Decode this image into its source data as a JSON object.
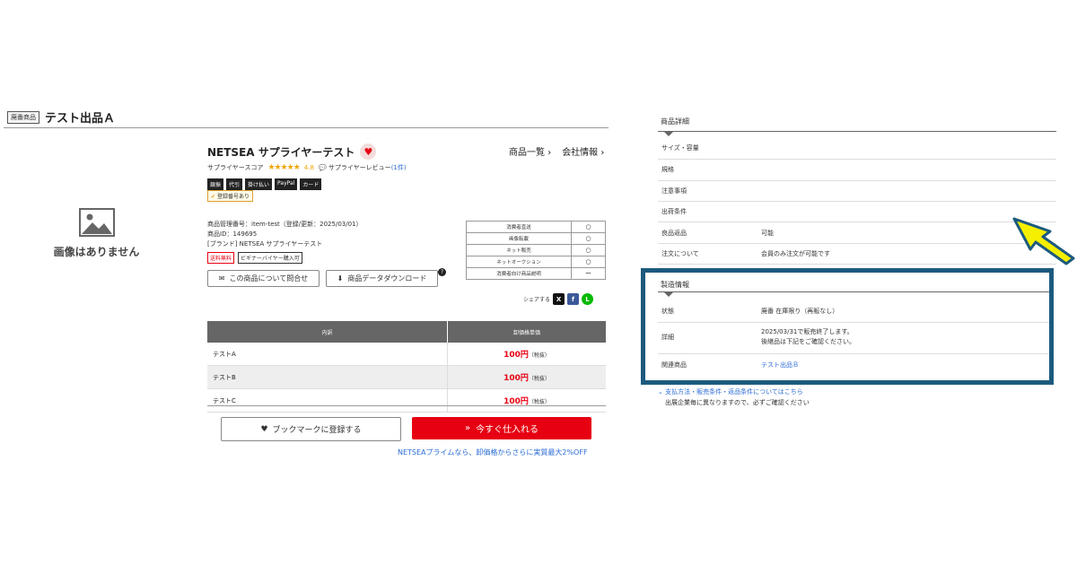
{
  "header": {
    "tag": "廃番商品",
    "title": "テスト出品Ａ"
  },
  "no_image": {
    "text": "画像はありません"
  },
  "supplier": {
    "name": "NETSEA サプライヤーテスト",
    "links": [
      "商品一覧",
      "会社情報"
    ],
    "score_label": "サプライヤースコア",
    "stars": "★★★★★",
    "score": "4.8",
    "review_label": "サプライヤーレビュー",
    "review_count": "(1件)",
    "payments": [
      "銀振",
      "代引",
      "掛け払い",
      "PayPal",
      "カード"
    ],
    "reg_no": "登録番号あり"
  },
  "product": {
    "manage_no": "商品管理番号：item-test（登録/更新：2025/03/01）",
    "product_id": "商品ID：149695",
    "brand": "[ブランド] NETSEA サプライヤーテスト",
    "badge_red": "送料無料",
    "badge_gray": "ビギナーバイヤー購入可",
    "inquiry_label": "この商品について問合せ",
    "download_label": "商品データダウンロード",
    "help": "?"
  },
  "features": [
    {
      "label": "消費者直送",
      "value": "○"
    },
    {
      "label": "画像転載",
      "value": "○"
    },
    {
      "label": "ネット販売",
      "value": "○"
    },
    {
      "label": "ネットオークション",
      "value": "○"
    },
    {
      "label": "消費者向け商品説明",
      "value": "ー"
    }
  ],
  "share": {
    "label": "シェアする",
    "buttons": [
      {
        "name": "x",
        "glyph": "X",
        "color": "#111111"
      },
      {
        "name": "facebook",
        "glyph": "f",
        "color": "#3b5998"
      },
      {
        "name": "line",
        "glyph": "L",
        "color": "#00b900"
      }
    ]
  },
  "price_table": {
    "headers": [
      "内訳",
      "卸価格単価"
    ],
    "rows": [
      {
        "name": "テストA",
        "price": "100円",
        "tax": "（税抜）"
      },
      {
        "name": "テストB",
        "price": "100円",
        "tax": "（税抜）"
      },
      {
        "name": "テストC",
        "price": "100円",
        "tax": "（税抜）"
      }
    ]
  },
  "actions": {
    "bookmark_label": "ブックマークに登録する",
    "buy_label": "今すぐ仕入れる",
    "prime_text": "NETSEAプライムなら、卸価格からさらに実質最大2%OFF"
  },
  "details": {
    "heading": "商品詳細",
    "rows": [
      {
        "label": "サイズ・容量",
        "value": ""
      },
      {
        "label": "規格",
        "value": ""
      },
      {
        "label": "注意事項",
        "value": ""
      },
      {
        "label": "出荷条件",
        "value": ""
      },
      {
        "label": "良品返品",
        "value": "可能"
      },
      {
        "label": "注文について",
        "value": "会員のみ注文が可能です"
      }
    ]
  },
  "manufacture": {
    "heading": "製造情報",
    "rows": [
      {
        "label": "状態",
        "value": "廃番 在庫限り（再販なし）"
      },
      {
        "label": "詳細",
        "value_line1": "2025/03/31で販売終了します。",
        "value_line2": "後継品は下記をご確認ください。"
      },
      {
        "label": "関連商品",
        "value": "テスト出品Ｂ"
      }
    ]
  },
  "payinfo": {
    "link": "支払方法・販売条件・返品条件についてはこちら",
    "note": "出展企業毎に異なりますので、必ずご確認ください"
  },
  "colors": {
    "accent_red": "#e60012",
    "link_blue": "#2a6bd6",
    "highlight_box": "#1c5a7e",
    "arrow_yellow": "#f5f000"
  }
}
